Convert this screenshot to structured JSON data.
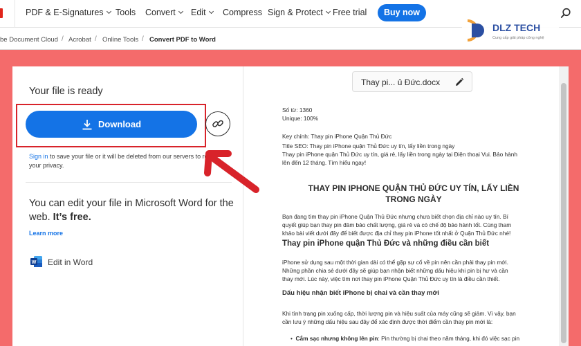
{
  "nav": {
    "items": [
      {
        "label": "PDF & E-Signatures",
        "dropdown": true
      },
      {
        "label": "Tools",
        "dropdown": false
      },
      {
        "label": "Convert",
        "dropdown": true
      },
      {
        "label": "Edit",
        "dropdown": true
      },
      {
        "label": "Compress",
        "dropdown": false
      },
      {
        "label": "Sign & Protect",
        "dropdown": true
      },
      {
        "label": "Free trial",
        "dropdown": false
      }
    ],
    "buy_label": "Buy now",
    "search_icon": "search-icon"
  },
  "breadcrumb": {
    "items": [
      "be Document Cloud",
      "Acrobat",
      "Online Tools",
      "Convert PDF to Word"
    ],
    "separator": "/"
  },
  "watermark": {
    "brand": "DLZ TECH",
    "tagline": "Cung cấp giải pháp công nghệ"
  },
  "left": {
    "title": "Your file is ready",
    "download_label": "Download",
    "signin_link": "Sign in",
    "signin_rest_line1": " to save your file or it will be deleted from our servers to resp",
    "signin_rest_line2": "your privacy.",
    "edit_heading_normal": "You can edit your file in Microsoft Word for the web. ",
    "edit_heading_bold": "It’s free.",
    "learn_more": "Learn more",
    "edit_in_word": "Edit in Word"
  },
  "preview": {
    "filename": "Thay pi... ủ Đức.docx",
    "lines": {
      "word_count": "Số từ: 1360",
      "unique": "Unique: 100%",
      "keyword": "Key chính: Thay pin iPhone Quận Thủ Đức",
      "title_seo": "Title SEO: Thay pin iPhone quận Thủ Đức uy tín, lấy liền trong ngày",
      "meta1": "Thay pin iPhone quận Thủ Đức uy tín, giá rẻ, lấy liền trong ngày tại Điện thoại Vui. Bảo hành",
      "meta2": "lên đến 12 tháng. Tìm hiểu ngay!",
      "h1_line1": "THAY PIN IPHONE QUẬN THỦ ĐỨC UY TÍN, LẤY LIỀN",
      "h1_line2": "TRONG NGÀY",
      "p1_1": "Bạn đang tìm thay pin iPhone Quận Thủ Đức nhưng chưa biết chọn địa chỉ nào uy tín. Bí",
      "p1_2": "quyết giúp bạn thay pin đảm bảo chất lượng, giá rẻ và có chế độ bảo hành tốt. Cùng tham",
      "p1_3": "khảo bài viết dưới đây để biết được địa chỉ thay pin iPhone tốt nhất ở Quận Thủ Đức nhé!",
      "h2": "Thay pin iPhone quận Thủ Đức và những điều cần biết",
      "p2_1": "iPhone sử dụng sau một thời gian dài có thể gặp sự cố về pin nên cần phải thay pin mới.",
      "p2_2": "Những phần chia sẻ dưới đây sẽ giúp bạn nhận biết những dấu hiệu khi pin bị hư và cần",
      "p2_3": "thay mới. Lúc này, việc tìm nơi thay pin iPhone Quận Thủ Đức uy tín là điều cần thiết.",
      "h3": "Dấu hiệu nhận biết iPhone bị chai và cần thay mới",
      "p3_1": "Khi tình trạng pin xuống cấp, thời lượng pin và hiệu suất của máy cũng sẽ giảm. Vì vậy, bạn",
      "p3_2": "cần lưu ý những dấu hiệu sau đây để xác định được thời điểm cần thay pin mới là:",
      "bullet_bold": "Cắm sạc nhưng không lên pin",
      "bullet_rest": ": Pin thường bị chai theo năm tháng, khi đó việc sạc pin"
    }
  },
  "colors": {
    "brand_blue": "#1473e6",
    "highlight_red": "#d8232a",
    "background": "#f46b6b"
  }
}
